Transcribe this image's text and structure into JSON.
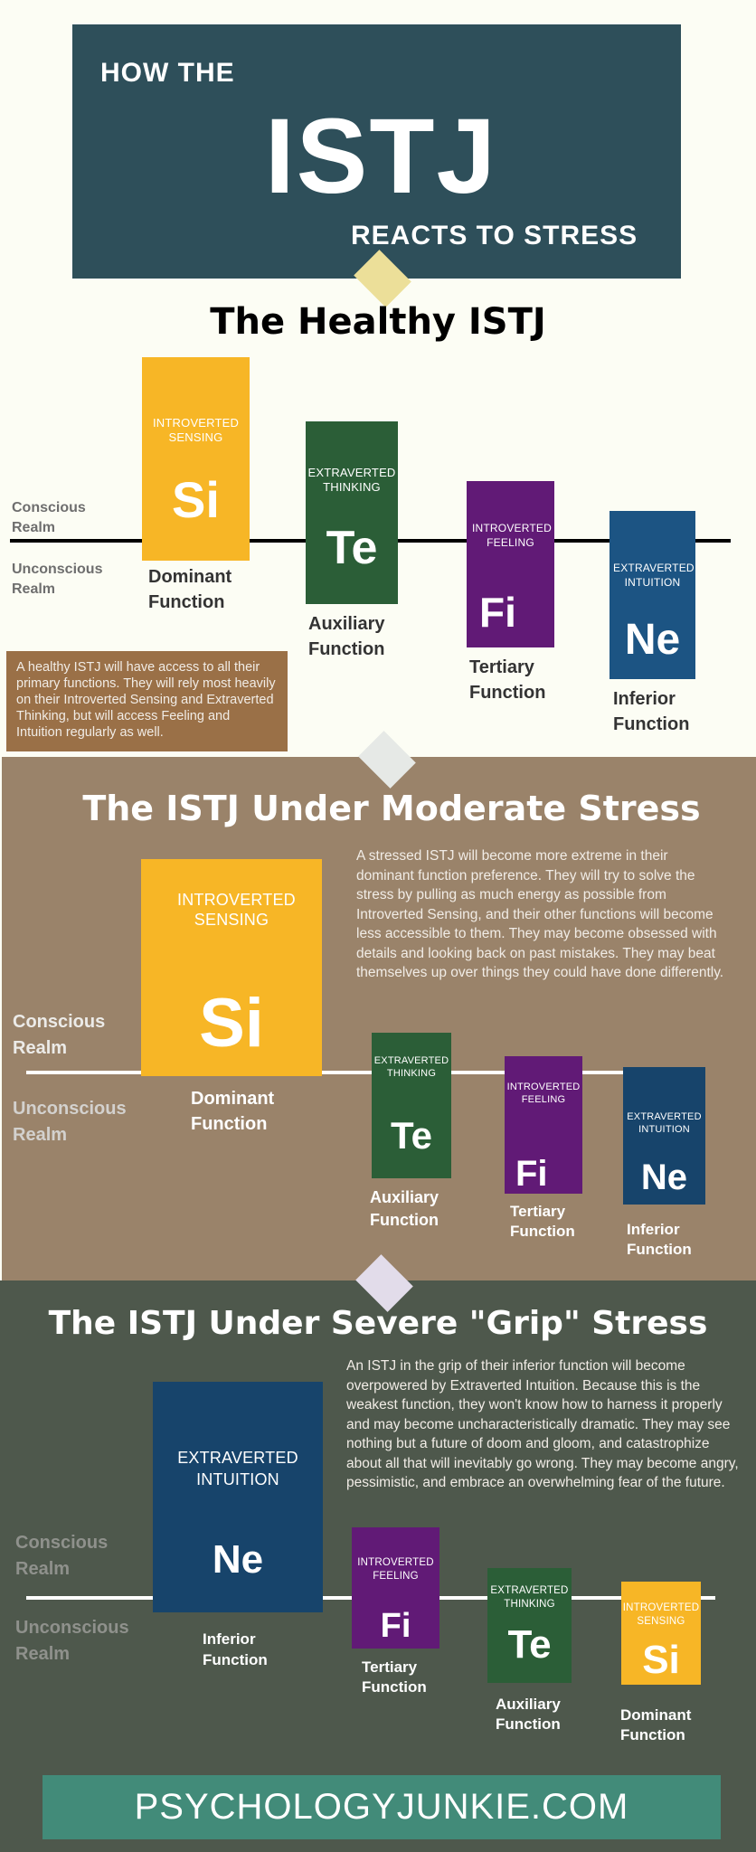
{
  "header": {
    "line1": "HOW THE",
    "type": "ISTJ",
    "line2": "REACTS TO STRESS"
  },
  "colors": {
    "header_bg": "#2e4f5a",
    "page_bg": "#fcfdf4",
    "moderate_bg": "#9a836a",
    "severe_bg": "#4e584c",
    "footer_bg": "#428b79",
    "si": "#f7b626",
    "te": "#2b5e37",
    "fi": "#611a76",
    "ne_healthy": "#1c5483",
    "ne": "#17446b",
    "note_bg": "#9a7047"
  },
  "realms": {
    "conscious": "Conscious Realm",
    "unconscious": "Unconscious Realm"
  },
  "healthy": {
    "title": "The Healthy ISTJ",
    "functions": [
      {
        "full": "INTROVERTED SENSING",
        "abbr": "Si",
        "role": "Dominant Function"
      },
      {
        "full": "EXTRAVERTED THINKING",
        "abbr": "Te",
        "role": "Auxiliary Function"
      },
      {
        "full": "INTROVERTED FEELING",
        "abbr": "Fi",
        "role": "Tertiary Function"
      },
      {
        "full": "EXTRAVERTED INTUITION",
        "abbr": "Ne",
        "role": "Inferior Function"
      }
    ],
    "description": "A healthy ISTJ will have access to all their primary functions. They will rely most heavily on their Introverted Sensing and Extraverted Thinking, but will access Feeling and Intuition regularly as well."
  },
  "moderate": {
    "title": "The ISTJ Under Moderate Stress",
    "functions": [
      {
        "full": "INTROVERTED SENSING",
        "abbr": "Si",
        "role": "Dominant Function"
      },
      {
        "full": "EXTRAVERTED THINKING",
        "abbr": "Te",
        "role": "Auxiliary Function"
      },
      {
        "full": "INTROVERTED FEELING",
        "abbr": "Fi",
        "role": "Tertiary Function"
      },
      {
        "full": "EXTRAVERTED INTUITION",
        "abbr": "Ne",
        "role": "Inferior Function"
      }
    ],
    "description": "A stressed ISTJ will become more extreme in their dominant function preference. They will try to solve the stress by pulling as much energy  as possible from Introverted Sensing, and their other functions will become less accessible to them. They may become obsessed with details and looking back on past mistakes. They may beat themselves up over things they could have done differently."
  },
  "severe": {
    "title": "The ISTJ Under Severe \"Grip\" Stress",
    "functions": [
      {
        "full": "EXTRAVERTED INTUITION",
        "abbr": "Ne",
        "role": "Inferior Function"
      },
      {
        "full": "INTROVERTED FEELING",
        "abbr": "Fi",
        "role": "Tertiary Function"
      },
      {
        "full": "EXTRAVERTED THINKING",
        "abbr": "Te",
        "role": "Auxiliary Function"
      },
      {
        "full": "INTROVERTED SENSING",
        "abbr": "Si",
        "role": "Dominant Function"
      }
    ],
    "description": "An ISTJ in the grip of their inferior function will become overpowered by Extraverted Intuition. Because this is the weakest function, they won't know how to harness it properly and may become uncharacteristically dramatic. They may see nothing but a future of doom and gloom, and catastrophize about all that will inevitably go wrong. They may become angry, pessimistic, and embrace an overwhelming fear of the future."
  },
  "footer": {
    "site": "PSYCHOLOGYJUNKIE.COM"
  }
}
